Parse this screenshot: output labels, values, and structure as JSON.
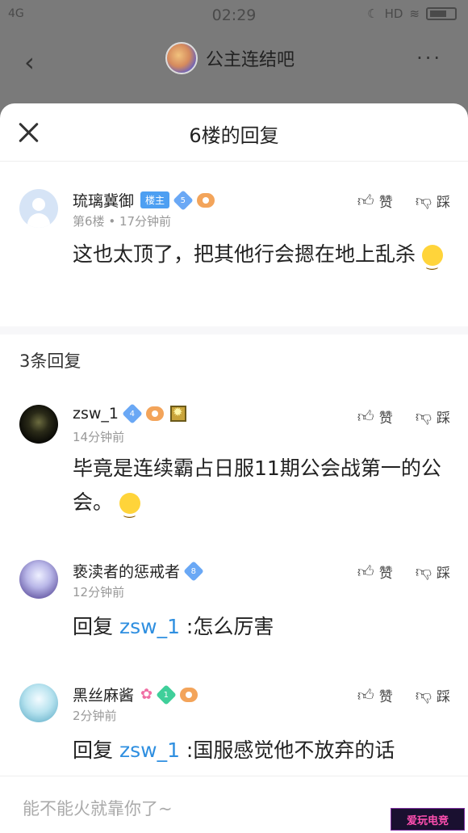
{
  "status_bar": {
    "network": "4G",
    "time": "02:29",
    "hd": "HD"
  },
  "top_bar": {
    "back_icon": "chevron-left-icon",
    "forum_name": "公主连结吧",
    "more_icon": "more-icon"
  },
  "sheet": {
    "title": "6楼的回复",
    "close_icon": "close-icon"
  },
  "main_post": {
    "username": "琉璃冀御",
    "host_badge": "楼主",
    "level": "5",
    "meta_floor": "第6楼",
    "meta_time": "17分钟前",
    "content": "这也太顶了，把其他行会摁在地上乱杀",
    "like_label": "赞",
    "dislike_label": "踩"
  },
  "reply_count": "3条回复",
  "replies": [
    {
      "username": "zsw_1",
      "level": "4",
      "time": "14分钟前",
      "content": "毕竟是连续霸占日服11期公会战第一的公会。",
      "like_label": "赞",
      "dislike_label": "踩"
    },
    {
      "username": "亵渎者的惩戒者",
      "level": "8",
      "time": "12分钟前",
      "reply_prefix": "回复",
      "mention": "zsw_1",
      "content": ":怎么厉害",
      "like_label": "赞",
      "dislike_label": "踩"
    },
    {
      "username": "黑丝麻酱",
      "level": "1",
      "time": "2分钟前",
      "reply_prefix": "回复",
      "mention": "zsw_1",
      "content": ":国服感觉他不放弃的话",
      "like_label": "赞",
      "dislike_label": "踩"
    }
  ],
  "input": {
    "placeholder": "能不能火就靠你了~"
  },
  "watermark": "爱玩电竞",
  "colors": {
    "accent": "#2f8fe0",
    "host_badge": "#4d9ff2",
    "dim_overlay": "#7a7a7a"
  }
}
